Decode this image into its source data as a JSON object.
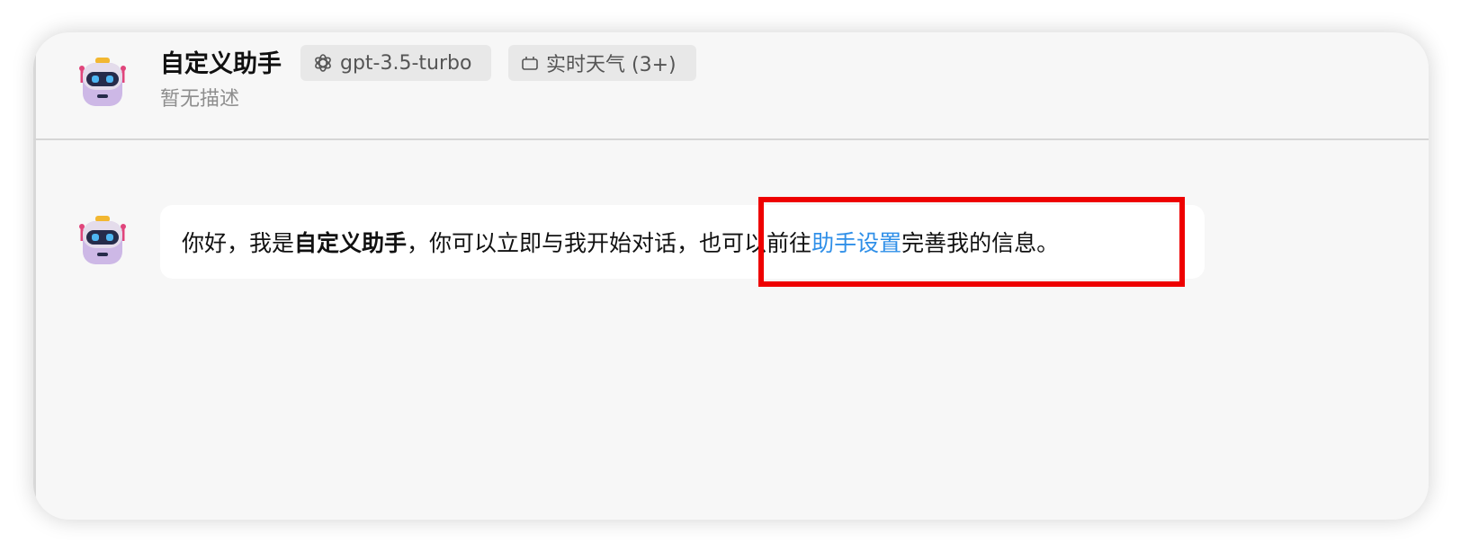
{
  "header": {
    "assistant_name": "自定义助手",
    "description": "暂无描述",
    "model_tag": {
      "label": "gpt-3.5-turbo",
      "icon": "openai-logo-icon"
    },
    "plugin_tag": {
      "label": "实时天气 (3+)",
      "icon": "plugin-icon"
    },
    "avatar_icon": "robot-avatar-icon"
  },
  "message": {
    "avatar_icon": "robot-avatar-icon",
    "text_part1": "你好，我是 ",
    "assistant_name": "自定义助手",
    "text_part2": "，你可以立即与我开始对话，",
    "text_part3": "也可以前往 ",
    "link_text": "助手设置",
    "text_part4": " 完善我的信息。"
  },
  "colors": {
    "link": "#2f8fe8",
    "highlight": "#ee0000",
    "background": "#f7f7f7",
    "tag_background": "#e8e8e8"
  }
}
